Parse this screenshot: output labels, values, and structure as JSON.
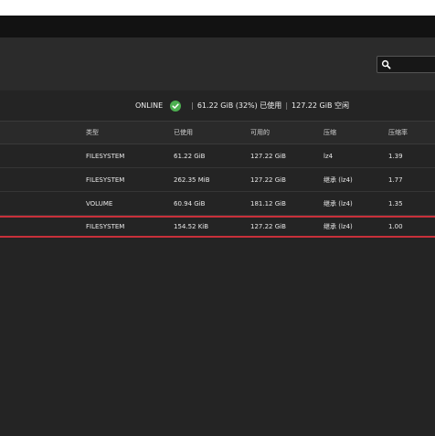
{
  "colors": {
    "accent_red": "#c8303a",
    "online_green": "#4caf50"
  },
  "search": {
    "placeholder": "",
    "value": ""
  },
  "status": {
    "state": "ONLINE",
    "used": "61.22 GiB (32%) 已使用",
    "separator": "|",
    "free": "127.22 GiB 空闲"
  },
  "table": {
    "headers": [
      "类型",
      "已使用",
      "可用的",
      "压缩",
      "压缩率"
    ],
    "rows": [
      [
        "FILESYSTEM",
        "61.22 GiB",
        "127.22 GiB",
        "lz4",
        "1.39"
      ],
      [
        "FILESYSTEM",
        "262.35 MiB",
        "127.22 GiB",
        "继承 (lz4)",
        "1.77"
      ],
      [
        "VOLUME",
        "60.94 GiB",
        "181.12 GiB",
        "继承 (lz4)",
        "1.35"
      ],
      [
        "FILESYSTEM",
        "154.52 KiB",
        "127.22 GiB",
        "继承 (lz4)",
        "1.00"
      ]
    ]
  }
}
